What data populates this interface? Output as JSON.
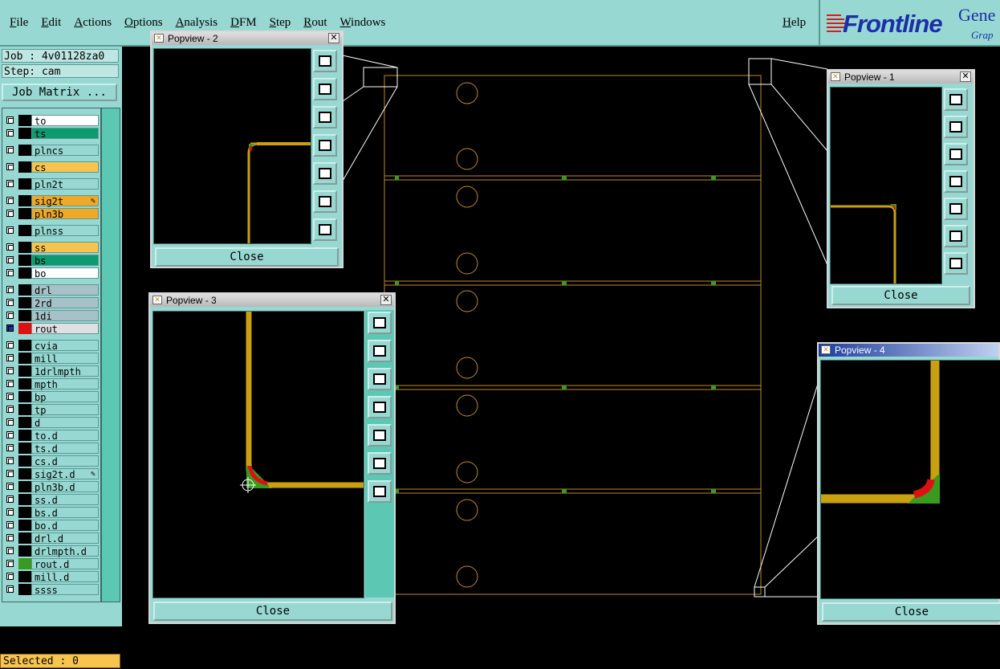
{
  "menubar": {
    "items": [
      "File",
      "Edit",
      "Actions",
      "Options",
      "Analysis",
      "DFM",
      "Step",
      "Rout",
      "Windows"
    ],
    "help": "Help"
  },
  "logo": {
    "brand": "Frontline",
    "product": "Gene",
    "sub": "Grap"
  },
  "left": {
    "job_label": "Job : 4v01128za0",
    "step_label": "Step: cam",
    "job_matrix": "Job Matrix ...",
    "selected": "Selected : 0"
  },
  "layers": [
    {
      "name": "to",
      "color": "#ffffff"
    },
    {
      "name": "ts",
      "color": "#0e9a70"
    },
    {
      "name": "plncs",
      "color": "#98d8d2"
    },
    {
      "name": "cs",
      "color": "#f8c450"
    },
    {
      "name": "pln2t",
      "color": "#98d8d2"
    },
    {
      "name": "sig2t",
      "color": "#f0a828",
      "mark": "✎"
    },
    {
      "name": "pln3b",
      "color": "#f0a828"
    },
    {
      "name": "plnss",
      "color": "#98d8d2"
    },
    {
      "name": "ss",
      "color": "#f8c450"
    },
    {
      "name": "bs",
      "color": "#0e9a70"
    },
    {
      "name": "bo",
      "color": "#ffffff"
    },
    {
      "name": "drl",
      "color": "#a8c0c8"
    },
    {
      "name": "2rd",
      "color": "#a8c0c8"
    },
    {
      "name": "1di",
      "color": "#a8c0c8"
    },
    {
      "name": "rout",
      "color": "#e0e0e0",
      "active": true
    },
    {
      "name": "cvia",
      "color": "#98d8d2"
    },
    {
      "name": "mill",
      "color": "#98d8d2"
    },
    {
      "name": "1drlmpth",
      "color": "#98d8d2"
    },
    {
      "name": "mpth",
      "color": "#98d8d2"
    },
    {
      "name": "bp",
      "color": "#98d8d2"
    },
    {
      "name": "tp",
      "color": "#98d8d2"
    },
    {
      "name": "d",
      "color": "#98d8d2"
    },
    {
      "name": "to.d",
      "color": "#98d8d2"
    },
    {
      "name": "ts.d",
      "color": "#98d8d2"
    },
    {
      "name": "cs.d",
      "color": "#98d8d2"
    },
    {
      "name": "sig2t.d",
      "color": "#98d8d2",
      "mark": "✎"
    },
    {
      "name": "pln3b.d",
      "color": "#98d8d2"
    },
    {
      "name": "ss.d",
      "color": "#98d8d2"
    },
    {
      "name": "bs.d",
      "color": "#98d8d2"
    },
    {
      "name": "bo.d",
      "color": "#98d8d2"
    },
    {
      "name": "drl.d",
      "color": "#98d8d2"
    },
    {
      "name": "drlmpth.d",
      "color": "#98d8d2"
    },
    {
      "name": "rout.d",
      "color": "#98d8d2",
      "swatch": "#3a9a20"
    },
    {
      "name": "mill.d",
      "color": "#98d8d2"
    },
    {
      "name": "ssss",
      "color": "#98d8d2"
    }
  ],
  "popviews": {
    "p1": {
      "title": "Popview - 1",
      "close": "Close"
    },
    "p2": {
      "title": "Popview - 2",
      "close": "Close"
    },
    "p3": {
      "title": "Popview - 3",
      "close": "Close"
    },
    "p4": {
      "title": "Popview - 4",
      "close": "Close"
    }
  },
  "colors": {
    "panel": "#98d8d2",
    "outline": "#c08830",
    "trace": "#c8a010",
    "red": "#e01010",
    "green": "#3a9a20"
  }
}
